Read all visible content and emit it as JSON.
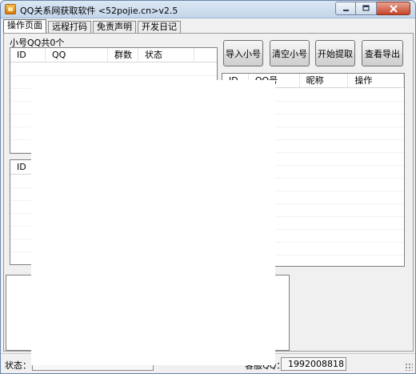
{
  "window": {
    "title": "QQ关系网获取软件 <52pojie.cn>v2.5",
    "controls": [
      "minimize",
      "maximize",
      "close"
    ]
  },
  "tabs": [
    {
      "label": "操作页面",
      "active": true
    },
    {
      "label": "远程打码",
      "active": false
    },
    {
      "label": "免责声明",
      "active": false
    },
    {
      "label": "开发日记",
      "active": false
    }
  ],
  "left_panel": {
    "count_label": "小号QQ共0个",
    "accounts_table": {
      "columns": [
        "ID",
        "QQ",
        "群数",
        "状态"
      ]
    },
    "second_table": {
      "columns": [
        "ID"
      ]
    }
  },
  "buttons": {
    "import": "导入小号",
    "clear": "清空小号",
    "start": "开始提取",
    "export": "查看导出"
  },
  "results_table": {
    "columns": [
      "ID",
      "QQ号",
      "昵称",
      "操作"
    ]
  },
  "statusbar": {
    "status_label": "状态：",
    "status_value": "",
    "support_label": "客服QQ：",
    "support_value": "1992008818"
  }
}
